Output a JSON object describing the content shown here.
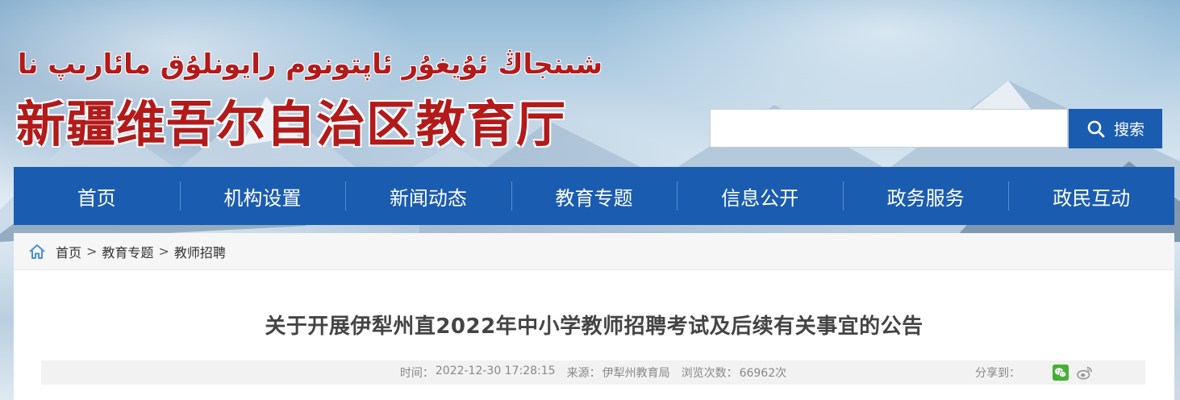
{
  "header": {
    "title_uyghur": "شىنجاڭ ئۇيغۇر ئاپتونوم رايونلۇق مائارىپ نازارىتى",
    "title_chinese": "新疆维吾尔自治区教育厅"
  },
  "search": {
    "placeholder": "",
    "button_label": "搜索",
    "button_icon": "search-icon"
  },
  "nav": {
    "items": [
      {
        "label": "首页"
      },
      {
        "label": "机构设置"
      },
      {
        "label": "新闻动态"
      },
      {
        "label": "教育专题"
      },
      {
        "label": "信息公开"
      },
      {
        "label": "政务服务"
      },
      {
        "label": "政民互动"
      }
    ]
  },
  "breadcrumb": {
    "icon": "home-icon",
    "items": [
      "首页",
      "教育专题",
      "教师招聘"
    ],
    "separator": ">"
  },
  "article": {
    "title": "关于开展伊犁州直2022年中小学教师招聘考试及后续有关事宜的公告",
    "time_label": "时间：",
    "time_value": "2022-12-30 17:28:15",
    "source_label": "来源：",
    "source_value": "伊犁州教育局",
    "views_label": "浏览次数：",
    "views_value": "66962次",
    "share_label": "分享到：",
    "share_icons": [
      "wechat-icon",
      "weibo-icon"
    ]
  },
  "colors": {
    "nav_bg": "#1a5cb0",
    "title_red": "#b31a1a",
    "wechat_green": "#44b035"
  }
}
